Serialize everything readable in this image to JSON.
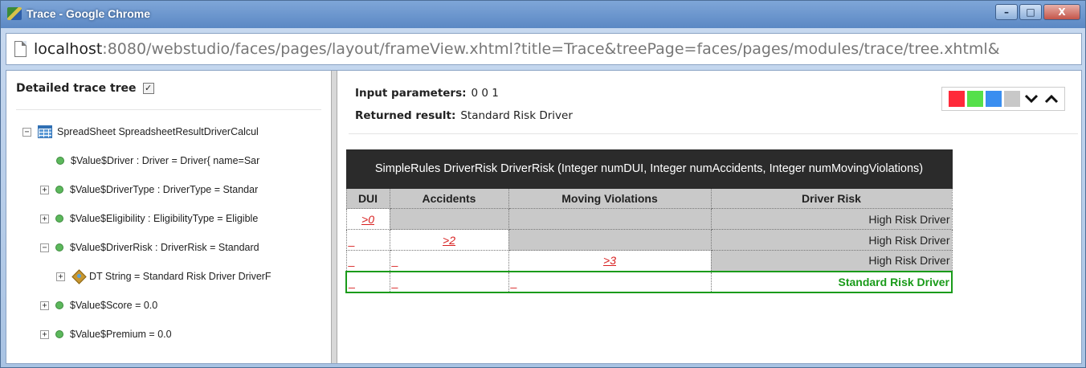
{
  "window": {
    "title": "Trace - Google Chrome",
    "buttons": {
      "minimize": "–",
      "maximize": "□",
      "close": "X"
    }
  },
  "address": {
    "host": "localhost",
    "rest": ":8080/webstudio/faces/pages/layout/frameView.xhtml?title=Trace&treePage=faces/pages/modules/trace/tree.xhtml&"
  },
  "tree": {
    "header": "Detailed trace tree",
    "detailed_checked": true,
    "nodes": [
      {
        "toggle": "−",
        "icon": "spreadsheet-icon",
        "label": "SpreadSheet SpreadsheetResultDriverCalcul"
      },
      {
        "toggle": "",
        "icon": "green-dot-icon",
        "label": "$Value$Driver : Driver = Driver{ name=Sar"
      },
      {
        "toggle": "+",
        "icon": "green-dot-icon",
        "label": "$Value$DriverType : DriverType = Standar"
      },
      {
        "toggle": "+",
        "icon": "green-dot-icon",
        "label": "$Value$Eligibility : EligibilityType = Eligible"
      },
      {
        "toggle": "−",
        "icon": "green-dot-icon",
        "label": "$Value$DriverRisk : DriverRisk = Standard"
      },
      {
        "toggle": "+",
        "icon": "decision-table-icon",
        "label": "DT String = Standard Risk Driver DriverF"
      },
      {
        "toggle": "+",
        "icon": "green-dot-icon",
        "label": "$Value$Score = 0.0"
      },
      {
        "toggle": "+",
        "icon": "green-dot-icon",
        "label": "$Value$Premium = 0.0"
      }
    ]
  },
  "details": {
    "input_label": "Input parameters:",
    "input_value": "0 0 1",
    "result_label": "Returned result:",
    "result_value": "Standard Risk Driver",
    "swatch_colors": [
      "#ff2a3a",
      "#55e04a",
      "#3a8ef0",
      "#c8c8c8"
    ],
    "chevron_down": "⌄",
    "chevron_up": "⌃"
  },
  "decision_table": {
    "title": "SimpleRules DriverRisk DriverRisk (Integer numDUI, Integer numAccidents, Integer numMovingViolations)",
    "columns": [
      "DUI",
      "Accidents",
      "Moving Violations",
      "Driver Risk"
    ],
    "rows": [
      {
        "dui": ">0",
        "accidents": "",
        "moving": "",
        "risk": "High Risk Driver"
      },
      {
        "dui": "_",
        "accidents": ">2",
        "moving": "",
        "risk": "High Risk Driver"
      },
      {
        "dui": "_",
        "accidents": "_",
        "moving": ">3",
        "risk": "High Risk Driver"
      },
      {
        "dui": "_",
        "accidents": "_",
        "moving": "_",
        "risk": "Standard Risk Driver"
      }
    ]
  }
}
